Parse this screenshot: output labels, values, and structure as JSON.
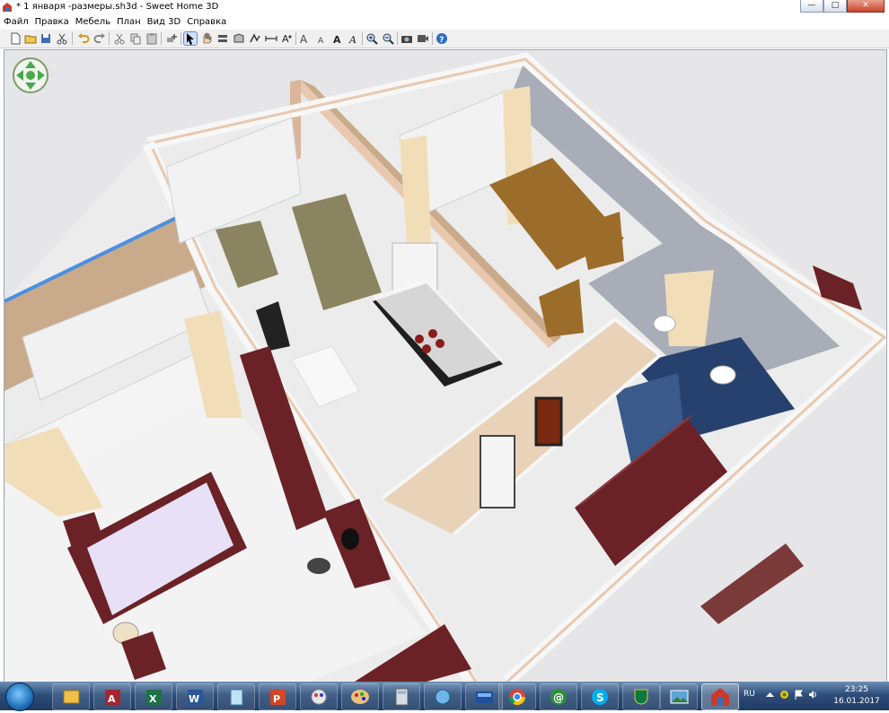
{
  "window": {
    "title": "* 1 января -размеры.sh3d - Sweet Home 3D",
    "icon": "sweet-home-3d-icon",
    "controls": [
      "minimize-icon",
      "maximize-icon",
      "close-icon"
    ]
  },
  "menu": [
    "Файл",
    "Правка",
    "Мебель",
    "План",
    "Вид 3D",
    "Справка"
  ],
  "toolbar": {
    "buttons": [
      "new-home-icon",
      "open-icon",
      "save-icon",
      "cut-icon",
      "undo-icon",
      "redo-icon",
      "cut-icon",
      "copy-icon",
      "paste-icon",
      "add-furniture-icon",
      "select-mode-icon",
      "pan-mode-icon",
      "create-walls-icon",
      "create-rooms-icon",
      "create-polylines-icon",
      "create-dimensions-icon",
      "create-labels-icon",
      "increase-text-icon",
      "decrease-text-icon",
      "bold-text-icon",
      "italic-text-icon",
      "zoom-in-icon",
      "zoom-out-icon",
      "create-photo-icon",
      "create-video-icon",
      "help-icon"
    ],
    "active": "select-mode-icon"
  },
  "view3d": {
    "navigation": "navigation-arrows-icon",
    "colors": {
      "background": "#e6e6e8",
      "wall_top": "#f7f7f7",
      "wall_edge": "#e8c9b0",
      "floor": "#ececec",
      "wallpaper": "#c9ab8b",
      "tile": "#a8adb8",
      "bathroom_floor": "#27416e",
      "furniture_wood": "#6b2226",
      "sofa": "#8b8460",
      "armchair": "#9c6d2a",
      "bed_sheet": "#e8e0f7",
      "curtain": "#f1deb8"
    }
  },
  "taskbar": {
    "start": "windows-start-orb",
    "apps": [
      "explorer-icon",
      "access-icon",
      "excel-icon",
      "word-icon",
      "notepad-icon",
      "powerpoint-icon",
      "paint-icon",
      "paint-palette-icon",
      "calculator-icon",
      "network-icon",
      "text-ru-icon",
      "chrome-icon",
      "mail-ru-agent-icon",
      "skype-icon",
      "kaspersky-icon",
      "photo-viewer-icon",
      "sweet-home-3d-icon"
    ],
    "active_app": "sweet-home-3d-icon",
    "language": "RU",
    "time": "23:25",
    "date": "16.01.2017"
  }
}
